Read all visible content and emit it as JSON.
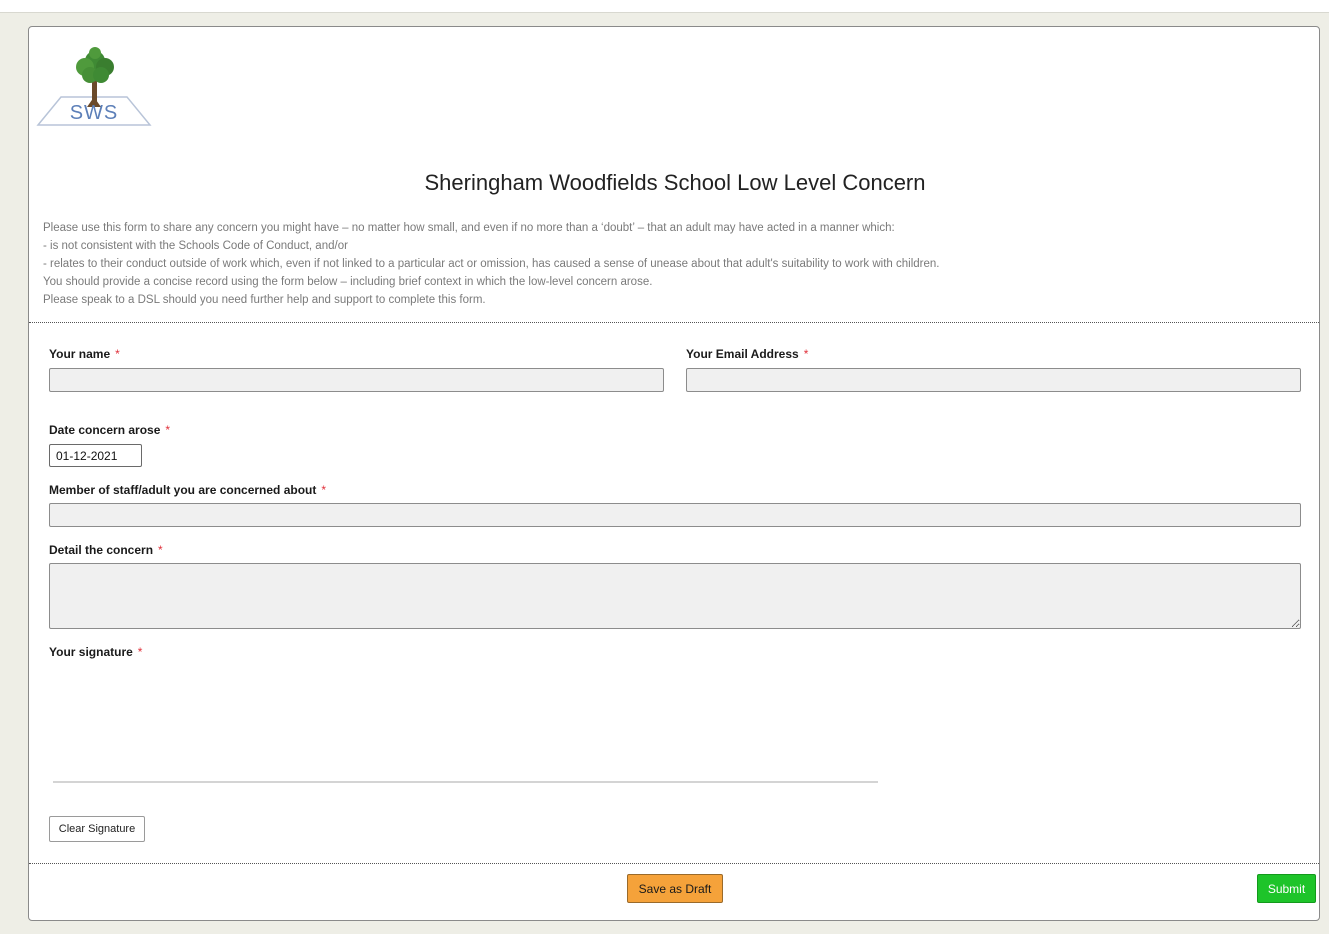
{
  "logo": {
    "text": "SWS",
    "icon": "tree-logo-icon",
    "colors": {
      "tree": "#3f8a34",
      "trunk": "#6b4a2a",
      "text": "#5c7fb8",
      "frame": "#b8c4d8"
    }
  },
  "form": {
    "title": "Sheringham Woodfields School Low Level Concern",
    "intro_lines": [
      "Please use this form to share any concern you might have – no matter how small, and even if no more than a ‘doubt’ – that an adult may have acted in a manner which:",
      "- is not consistent with the Schools Code of Conduct, and/or",
      "- relates to their conduct outside of work which, even if not linked to a particular act or omission, has caused a sense of unease about that adult's suitability to work with children.",
      "You should provide a concise record using the form below – including brief context in which the low-level concern arose.",
      "Please speak to a DSL should you need further help and support to complete this form."
    ],
    "required_marker": "*",
    "fields": {
      "name": {
        "label": "Your name",
        "value": ""
      },
      "email": {
        "label": "Your Email Address",
        "value": ""
      },
      "date": {
        "label": "Date concern arose",
        "value": "01-12-2021"
      },
      "staff": {
        "label": "Member of staff/adult you are concerned about",
        "value": ""
      },
      "detail": {
        "label": "Detail the concern",
        "value": ""
      },
      "signature": {
        "label": "Your signature"
      }
    }
  },
  "buttons": {
    "clear_signature": "Clear Signature",
    "save_draft": "Save as Draft",
    "submit": "Submit"
  },
  "colors": {
    "required": "#e0303a",
    "draft_button": "#f5a23a",
    "submit_button": "#1ec42a",
    "page_background": "#eeeee6"
  }
}
